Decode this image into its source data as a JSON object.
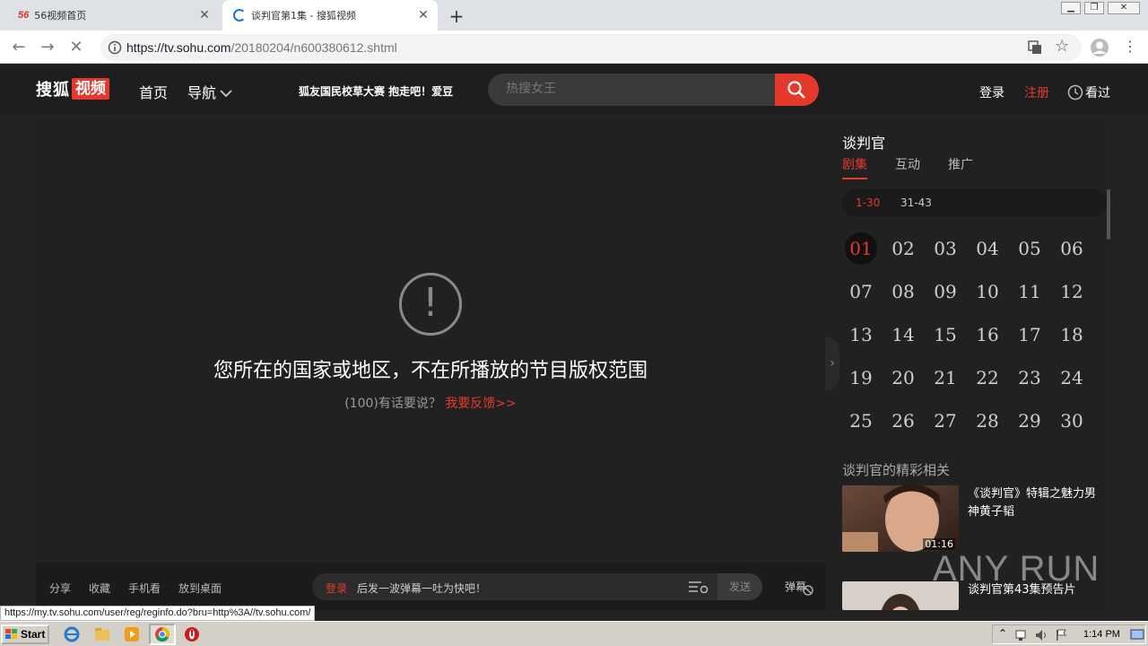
{
  "browser": {
    "tabs": [
      {
        "favicon": "56",
        "title": "56视频首页",
        "active": false
      },
      {
        "title": "谈判官第1集 - 搜狐视频",
        "active": true,
        "loading": true
      }
    ],
    "url_host": "https://tv.sohu.com",
    "url_path": "/20180204/n600380612.shtml",
    "status_url": "https://my.tv.sohu.com/user/reg/reginfo.do?bru=http%3A//tv.sohu.com/"
  },
  "header": {
    "logo_text": "搜狐",
    "logo_badge": "视频",
    "nav_home": "首页",
    "nav_guide": "导航",
    "promo": "狐友国民校草大赛  抱走吧！爱豆",
    "search_placeholder": "热搜女王",
    "login": "登录",
    "register": "注册",
    "history": "看过",
    "accent_color": "#e5392d"
  },
  "player": {
    "message": "您所在的国家或地区，不在所播放的节目版权范围",
    "feedback_count": "(100)有话要说？",
    "feedback_link": "我要反馈>>",
    "bar": {
      "share": "分享",
      "favorite": "收藏",
      "mobile": "手机看",
      "desktop": "放到桌面",
      "danmu_login": "登录",
      "danmu_placeholder": "后发一波弹幕一吐为快吧！",
      "send": "发送",
      "danmu_toggle": "弹幕"
    }
  },
  "sidebar": {
    "title": "谈判官",
    "tabs": [
      "剧集",
      "互动",
      "推广"
    ],
    "ranges": [
      "1-30",
      "31-43"
    ],
    "episodes": [
      "01",
      "02",
      "03",
      "04",
      "05",
      "06",
      "07",
      "08",
      "09",
      "10",
      "11",
      "12",
      "13",
      "14",
      "15",
      "16",
      "17",
      "18",
      "19",
      "20",
      "21",
      "22",
      "23",
      "24",
      "25",
      "26",
      "27",
      "28",
      "29",
      "30"
    ],
    "active_episode": "01",
    "related_title": "谈判官的精彩相关",
    "related": [
      {
        "title": "《谈判官》特辑之魅力男神黄子韬",
        "duration": "01:16"
      },
      {
        "title": "谈判官第43集预告片",
        "duration": ""
      }
    ]
  },
  "watermark": "ANY RUN",
  "taskbar": {
    "start": "Start",
    "clock": "1:14 PM"
  }
}
